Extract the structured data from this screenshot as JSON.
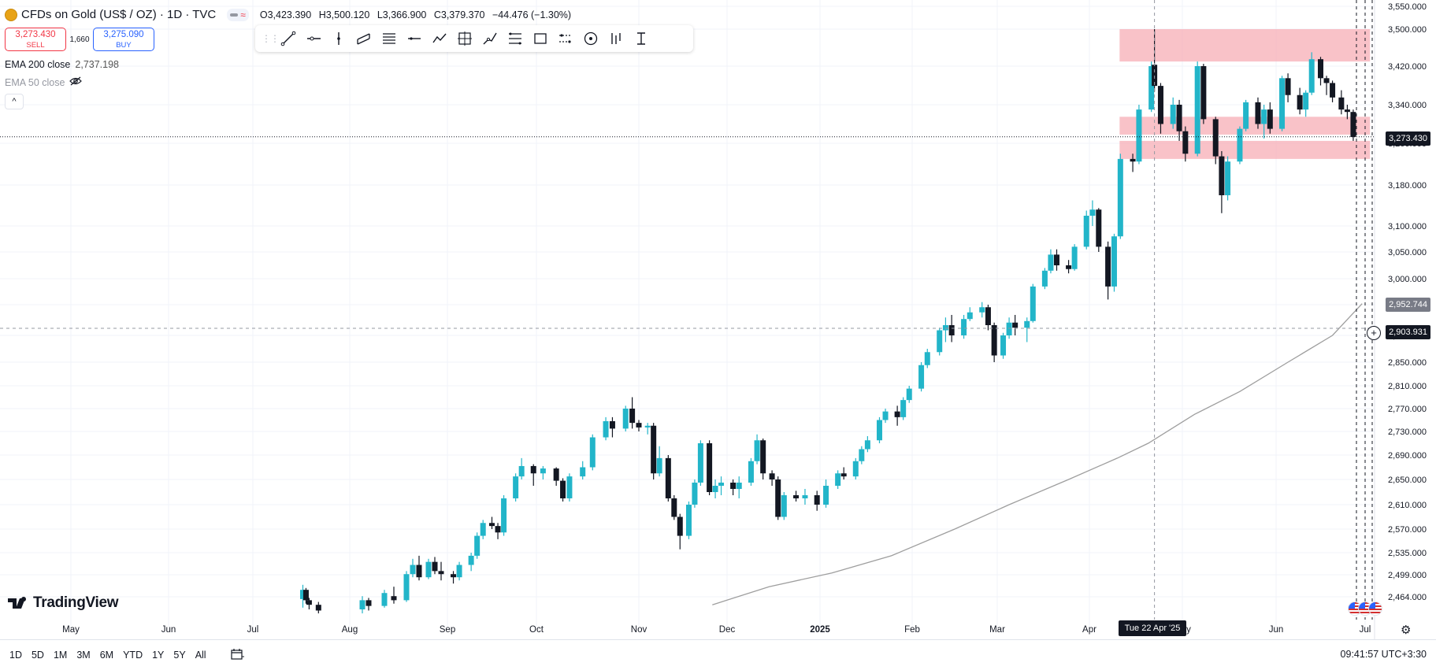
{
  "header": {
    "symbol": "CFDs on Gold (US$ / OZ) · 1D · TVC",
    "open": "O3,423.390",
    "high": "H3,500.120",
    "low": "L3,366.900",
    "close": "C3,379.370",
    "change": "−44.476 (−1.30%)"
  },
  "trade": {
    "sell_price": "3,273.430",
    "sell_label": "SELL",
    "spread": "1,660",
    "buy_price": "3,275.090",
    "buy_label": "BUY"
  },
  "indicators": {
    "ema200_label": "EMA 200 close",
    "ema200_value": "2,737.198",
    "ema50_label": "EMA 50 close",
    "collapse_icon": "^"
  },
  "price_tags": {
    "current": "3,273.430",
    "ema": "2,952.744",
    "crosshair": "2,903.931"
  },
  "crosshair_date": "Tue 22 Apr '25",
  "bottom": {
    "ranges": [
      "1D",
      "5D",
      "1M",
      "3M",
      "6M",
      "YTD",
      "1Y",
      "5Y",
      "All"
    ],
    "clock": "09:41:57 UTC+3:30"
  },
  "logo_text": "TradingView",
  "colors": {
    "up": "#22b5c9",
    "down": "#131722",
    "zone": "#f7a8b1",
    "ema": "#9e9e9e",
    "sell": "#f23645",
    "buy": "#2962ff"
  },
  "toolbar_icons": [
    "trend-line-icon",
    "horizontal-ray-icon",
    "vertical-line-icon",
    "parallel-channel-icon",
    "pitchfork-icon",
    "horizontal-line-icon",
    "path-icon",
    "date-price-range-icon",
    "brush-icon",
    "fib-retracement-icon",
    "rectangle-icon",
    "long-position-icon",
    "circle-icon",
    "bar-pattern-icon",
    "measure-icon"
  ],
  "chart_data": {
    "type": "candlestick",
    "y_ticks": [
      3550,
      3500,
      3420,
      3340,
      3260,
      3180,
      3100,
      3050,
      3000,
      2950,
      2890,
      2850,
      2810,
      2770,
      2730,
      2690,
      2650,
      2610,
      2570,
      2535,
      2499,
      2464
    ],
    "y_tick_labels": [
      "3,550.000",
      "3,500.000",
      "3,420.000",
      "3,340.000",
      "3,260.000",
      "3,180.000",
      "3,100.000",
      "3,050.000",
      "3,000.000",
      "2,950.000",
      "2,890.000",
      "2,850.000",
      "2,810.000",
      "2,770.000",
      "2,730.000",
      "2,690.000",
      "2,650.000",
      "2,610.000",
      "2,570.000",
      "2,535.000",
      "2,499.000",
      "2,464.000"
    ],
    "x_labels": [
      "May",
      "Jun",
      "Jul",
      "Aug",
      "Sep",
      "Oct",
      "Nov",
      "Dec",
      "2025",
      "Feb",
      "Mar",
      "Apr",
      "May",
      "Jun",
      "Jul"
    ],
    "x_label_dates": [
      "2024-05-01",
      "2024-06-01",
      "2024-07-01",
      "2024-08-01",
      "2024-09-01",
      "2024-10-01",
      "2024-11-01",
      "2024-12-01",
      "2025-01-01",
      "2025-02-01",
      "2025-03-01",
      "2025-04-01",
      "2025-05-01",
      "2025-06-01",
      "2025-07-01"
    ],
    "x_range": [
      "2024-04-20",
      "2025-07-02"
    ],
    "zones": [
      {
        "y_from": 3430,
        "y_to": 3500
      },
      {
        "y_from": 3278,
        "y_to": 3315
      },
      {
        "y_from": 3230,
        "y_to": 3265
      }
    ],
    "ema200": [
      {
        "d": "2024-11-26",
        "v": 2450
      },
      {
        "d": "2024-12-15",
        "v": 2480
      },
      {
        "d": "2025-01-05",
        "v": 2502
      },
      {
        "d": "2025-01-25",
        "v": 2530
      },
      {
        "d": "2025-02-15",
        "v": 2570
      },
      {
        "d": "2025-03-05",
        "v": 2610
      },
      {
        "d": "2025-03-25",
        "v": 2650
      },
      {
        "d": "2025-04-10",
        "v": 2685
      },
      {
        "d": "2025-04-20",
        "v": 2710
      },
      {
        "d": "2025-05-05",
        "v": 2760
      },
      {
        "d": "2025-05-20",
        "v": 2800
      },
      {
        "d": "2025-06-05",
        "v": 2850
      },
      {
        "d": "2025-06-20",
        "v": 2890
      },
      {
        "d": "2025-06-30",
        "v": 2952
      }
    ],
    "candles": [
      {
        "d": "2024-07-17",
        "o": 2460,
        "h": 2483,
        "l": 2445,
        "c": 2475
      },
      {
        "d": "2024-07-18",
        "o": 2475,
        "h": 2478,
        "l": 2452,
        "c": 2458
      },
      {
        "d": "2024-07-19",
        "o": 2458,
        "h": 2462,
        "l": 2442,
        "c": 2450
      },
      {
        "d": "2024-07-22",
        "o": 2450,
        "h": 2455,
        "l": 2435,
        "c": 2440
      },
      {
        "d": "2024-08-05",
        "o": 2442,
        "h": 2465,
        "l": 2435,
        "c": 2458
      },
      {
        "d": "2024-08-07",
        "o": 2458,
        "h": 2462,
        "l": 2440,
        "c": 2448
      },
      {
        "d": "2024-08-12",
        "o": 2448,
        "h": 2475,
        "l": 2445,
        "c": 2470
      },
      {
        "d": "2024-08-15",
        "o": 2465,
        "h": 2480,
        "l": 2452,
        "c": 2458
      },
      {
        "d": "2024-08-19",
        "o": 2458,
        "h": 2505,
        "l": 2455,
        "c": 2500
      },
      {
        "d": "2024-08-21",
        "o": 2500,
        "h": 2525,
        "l": 2495,
        "c": 2515
      },
      {
        "d": "2024-08-23",
        "o": 2515,
        "h": 2530,
        "l": 2490,
        "c": 2495
      },
      {
        "d": "2024-08-26",
        "o": 2495,
        "h": 2525,
        "l": 2492,
        "c": 2520
      },
      {
        "d": "2024-08-28",
        "o": 2520,
        "h": 2528,
        "l": 2500,
        "c": 2505
      },
      {
        "d": "2024-08-30",
        "o": 2505,
        "h": 2520,
        "l": 2490,
        "c": 2500
      },
      {
        "d": "2024-09-03",
        "o": 2500,
        "h": 2505,
        "l": 2485,
        "c": 2495
      },
      {
        "d": "2024-09-05",
        "o": 2495,
        "h": 2520,
        "l": 2490,
        "c": 2515
      },
      {
        "d": "2024-09-09",
        "o": 2515,
        "h": 2535,
        "l": 2505,
        "c": 2530
      },
      {
        "d": "2024-09-11",
        "o": 2530,
        "h": 2565,
        "l": 2525,
        "c": 2560
      },
      {
        "d": "2024-09-13",
        "o": 2560,
        "h": 2585,
        "l": 2555,
        "c": 2580
      },
      {
        "d": "2024-09-16",
        "o": 2580,
        "h": 2590,
        "l": 2570,
        "c": 2575
      },
      {
        "d": "2024-09-18",
        "o": 2575,
        "h": 2580,
        "l": 2555,
        "c": 2565
      },
      {
        "d": "2024-09-20",
        "o": 2565,
        "h": 2625,
        "l": 2560,
        "c": 2620
      },
      {
        "d": "2024-09-24",
        "o": 2620,
        "h": 2660,
        "l": 2615,
        "c": 2655
      },
      {
        "d": "2024-09-26",
        "o": 2655,
        "h": 2685,
        "l": 2650,
        "c": 2672
      },
      {
        "d": "2024-09-30",
        "o": 2672,
        "h": 2675,
        "l": 2640,
        "c": 2660
      },
      {
        "d": "2024-10-03",
        "o": 2660,
        "h": 2672,
        "l": 2650,
        "c": 2668
      },
      {
        "d": "2024-10-07",
        "o": 2668,
        "h": 2670,
        "l": 2640,
        "c": 2648
      },
      {
        "d": "2024-10-09",
        "o": 2648,
        "h": 2652,
        "l": 2615,
        "c": 2620
      },
      {
        "d": "2024-10-11",
        "o": 2620,
        "h": 2660,
        "l": 2615,
        "c": 2655
      },
      {
        "d": "2024-10-15",
        "o": 2655,
        "h": 2680,
        "l": 2650,
        "c": 2670
      },
      {
        "d": "2024-10-18",
        "o": 2670,
        "h": 2725,
        "l": 2665,
        "c": 2720
      },
      {
        "d": "2024-10-22",
        "o": 2720,
        "h": 2755,
        "l": 2715,
        "c": 2748
      },
      {
        "d": "2024-10-24",
        "o": 2748,
        "h": 2755,
        "l": 2720,
        "c": 2735
      },
      {
        "d": "2024-10-28",
        "o": 2735,
        "h": 2775,
        "l": 2730,
        "c": 2770
      },
      {
        "d": "2024-10-30",
        "o": 2770,
        "h": 2790,
        "l": 2735,
        "c": 2745
      },
      {
        "d": "2024-11-01",
        "o": 2745,
        "h": 2750,
        "l": 2730,
        "c": 2737
      },
      {
        "d": "2024-11-04",
        "o": 2737,
        "h": 2745,
        "l": 2725,
        "c": 2740
      },
      {
        "d": "2024-11-06",
        "o": 2740,
        "h": 2745,
        "l": 2650,
        "c": 2660
      },
      {
        "d": "2024-11-08",
        "o": 2660,
        "h": 2705,
        "l": 2655,
        "c": 2685
      },
      {
        "d": "2024-11-11",
        "o": 2685,
        "h": 2690,
        "l": 2615,
        "c": 2620
      },
      {
        "d": "2024-11-13",
        "o": 2620,
        "h": 2625,
        "l": 2585,
        "c": 2590
      },
      {
        "d": "2024-11-15",
        "o": 2590,
        "h": 2595,
        "l": 2540,
        "c": 2560
      },
      {
        "d": "2024-11-18",
        "o": 2560,
        "h": 2615,
        "l": 2555,
        "c": 2610
      },
      {
        "d": "2024-11-20",
        "o": 2610,
        "h": 2650,
        "l": 2605,
        "c": 2645
      },
      {
        "d": "2024-11-22",
        "o": 2645,
        "h": 2715,
        "l": 2640,
        "c": 2710
      },
      {
        "d": "2024-11-25",
        "o": 2710,
        "h": 2715,
        "l": 2625,
        "c": 2630
      },
      {
        "d": "2024-11-27",
        "o": 2630,
        "h": 2650,
        "l": 2620,
        "c": 2640
      },
      {
        "d": "2024-11-29",
        "o": 2640,
        "h": 2655,
        "l": 2625,
        "c": 2645
      },
      {
        "d": "2024-12-03",
        "o": 2645,
        "h": 2650,
        "l": 2625,
        "c": 2635
      },
      {
        "d": "2024-12-05",
        "o": 2635,
        "h": 2655,
        "l": 2620,
        "c": 2645
      },
      {
        "d": "2024-12-09",
        "o": 2645,
        "h": 2685,
        "l": 2640,
        "c": 2680
      },
      {
        "d": "2024-12-11",
        "o": 2680,
        "h": 2725,
        "l": 2675,
        "c": 2715
      },
      {
        "d": "2024-12-13",
        "o": 2715,
        "h": 2718,
        "l": 2650,
        "c": 2660
      },
      {
        "d": "2024-12-16",
        "o": 2660,
        "h": 2665,
        "l": 2640,
        "c": 2650
      },
      {
        "d": "2024-12-18",
        "o": 2650,
        "h": 2655,
        "l": 2585,
        "c": 2590
      },
      {
        "d": "2024-12-20",
        "o": 2590,
        "h": 2630,
        "l": 2585,
        "c": 2625
      },
      {
        "d": "2024-12-24",
        "o": 2625,
        "h": 2632,
        "l": 2615,
        "c": 2620
      },
      {
        "d": "2024-12-27",
        "o": 2620,
        "h": 2635,
        "l": 2610,
        "c": 2625
      },
      {
        "d": "2024-12-31",
        "o": 2625,
        "h": 2632,
        "l": 2600,
        "c": 2610
      },
      {
        "d": "2025-01-03",
        "o": 2610,
        "h": 2650,
        "l": 2605,
        "c": 2640
      },
      {
        "d": "2025-01-07",
        "o": 2640,
        "h": 2665,
        "l": 2635,
        "c": 2660
      },
      {
        "d": "2025-01-09",
        "o": 2660,
        "h": 2670,
        "l": 2650,
        "c": 2655
      },
      {
        "d": "2025-01-13",
        "o": 2655,
        "h": 2685,
        "l": 2650,
        "c": 2680
      },
      {
        "d": "2025-01-15",
        "o": 2680,
        "h": 2705,
        "l": 2675,
        "c": 2700
      },
      {
        "d": "2025-01-17",
        "o": 2700,
        "h": 2722,
        "l": 2695,
        "c": 2715
      },
      {
        "d": "2025-01-21",
        "o": 2715,
        "h": 2755,
        "l": 2710,
        "c": 2750
      },
      {
        "d": "2025-01-23",
        "o": 2750,
        "h": 2770,
        "l": 2745,
        "c": 2765
      },
      {
        "d": "2025-01-27",
        "o": 2765,
        "h": 2775,
        "l": 2740,
        "c": 2755
      },
      {
        "d": "2025-01-29",
        "o": 2755,
        "h": 2790,
        "l": 2750,
        "c": 2785
      },
      {
        "d": "2025-01-31",
        "o": 2785,
        "h": 2810,
        "l": 2780,
        "c": 2805
      },
      {
        "d": "2025-02-04",
        "o": 2805,
        "h": 2850,
        "l": 2800,
        "c": 2845
      },
      {
        "d": "2025-02-06",
        "o": 2845,
        "h": 2870,
        "l": 2840,
        "c": 2865
      },
      {
        "d": "2025-02-10",
        "o": 2865,
        "h": 2905,
        "l": 2860,
        "c": 2900
      },
      {
        "d": "2025-02-12",
        "o": 2900,
        "h": 2925,
        "l": 2880,
        "c": 2910
      },
      {
        "d": "2025-02-14",
        "o": 2910,
        "h": 2930,
        "l": 2880,
        "c": 2890
      },
      {
        "d": "2025-02-18",
        "o": 2890,
        "h": 2930,
        "l": 2885,
        "c": 2922
      },
      {
        "d": "2025-02-20",
        "o": 2922,
        "h": 2945,
        "l": 2918,
        "c": 2935
      },
      {
        "d": "2025-02-24",
        "o": 2935,
        "h": 2955,
        "l": 2925,
        "c": 2945
      },
      {
        "d": "2025-02-26",
        "o": 2945,
        "h": 2950,
        "l": 2900,
        "c": 2910
      },
      {
        "d": "2025-02-28",
        "o": 2910,
        "h": 2915,
        "l": 2850,
        "c": 2860
      },
      {
        "d": "2025-03-03",
        "o": 2860,
        "h": 2895,
        "l": 2855,
        "c": 2890
      },
      {
        "d": "2025-03-05",
        "o": 2890,
        "h": 2925,
        "l": 2885,
        "c": 2915
      },
      {
        "d": "2025-03-07",
        "o": 2915,
        "h": 2930,
        "l": 2890,
        "c": 2905
      },
      {
        "d": "2025-03-11",
        "o": 2905,
        "h": 2925,
        "l": 2880,
        "c": 2918
      },
      {
        "d": "2025-03-13",
        "o": 2918,
        "h": 2990,
        "l": 2915,
        "c": 2985
      },
      {
        "d": "2025-03-17",
        "o": 2985,
        "h": 3020,
        "l": 2980,
        "c": 3015
      },
      {
        "d": "2025-03-19",
        "o": 3015,
        "h": 3055,
        "l": 3010,
        "c": 3045
      },
      {
        "d": "2025-03-21",
        "o": 3045,
        "h": 3055,
        "l": 3015,
        "c": 3025
      },
      {
        "d": "2025-03-25",
        "o": 3025,
        "h": 3035,
        "l": 3010,
        "c": 3018
      },
      {
        "d": "2025-03-27",
        "o": 3018,
        "h": 3065,
        "l": 3015,
        "c": 3060
      },
      {
        "d": "2025-03-31",
        "o": 3060,
        "h": 3130,
        "l": 3055,
        "c": 3120
      },
      {
        "d": "2025-04-02",
        "o": 3120,
        "h": 3150,
        "l": 3100,
        "c": 3132
      },
      {
        "d": "2025-04-04",
        "o": 3132,
        "h": 3135,
        "l": 3050,
        "c": 3060
      },
      {
        "d": "2025-04-07",
        "o": 3060,
        "h": 3070,
        "l": 2960,
        "c": 2985
      },
      {
        "d": "2025-04-09",
        "o": 2985,
        "h": 3085,
        "l": 2975,
        "c": 3080
      },
      {
        "d": "2025-04-11",
        "o": 3080,
        "h": 3240,
        "l": 3075,
        "c": 3230
      },
      {
        "d": "2025-04-15",
        "o": 3230,
        "h": 3240,
        "l": 3205,
        "c": 3225
      },
      {
        "d": "2025-04-17",
        "o": 3225,
        "h": 3340,
        "l": 3220,
        "c": 3330
      },
      {
        "d": "2025-04-21",
        "o": 3330,
        "h": 3430,
        "l": 3325,
        "c": 3420
      },
      {
        "d": "2025-04-22",
        "o": 3423,
        "h": 3500,
        "l": 3367,
        "c": 3379
      },
      {
        "d": "2025-04-24",
        "o": 3379,
        "h": 3385,
        "l": 3280,
        "c": 3300
      },
      {
        "d": "2025-04-28",
        "o": 3300,
        "h": 3355,
        "l": 3290,
        "c": 3340
      },
      {
        "d": "2025-04-30",
        "o": 3340,
        "h": 3350,
        "l": 3265,
        "c": 3285
      },
      {
        "d": "2025-05-02",
        "o": 3285,
        "h": 3295,
        "l": 3225,
        "c": 3240
      },
      {
        "d": "2025-05-06",
        "o": 3240,
        "h": 3430,
        "l": 3235,
        "c": 3420
      },
      {
        "d": "2025-05-08",
        "o": 3420,
        "h": 3425,
        "l": 3300,
        "c": 3310
      },
      {
        "d": "2025-05-12",
        "o": 3310,
        "h": 3315,
        "l": 3220,
        "c": 3235
      },
      {
        "d": "2025-05-14",
        "o": 3235,
        "h": 3245,
        "l": 3125,
        "c": 3160
      },
      {
        "d": "2025-05-16",
        "o": 3160,
        "h": 3235,
        "l": 3150,
        "c": 3225
      },
      {
        "d": "2025-05-20",
        "o": 3225,
        "h": 3295,
        "l": 3220,
        "c": 3290
      },
      {
        "d": "2025-05-22",
        "o": 3290,
        "h": 3350,
        "l": 3285,
        "c": 3345
      },
      {
        "d": "2025-05-26",
        "o": 3345,
        "h": 3355,
        "l": 3290,
        "c": 3300
      },
      {
        "d": "2025-05-28",
        "o": 3300,
        "h": 3340,
        "l": 3270,
        "c": 3330
      },
      {
        "d": "2025-05-30",
        "o": 3330,
        "h": 3345,
        "l": 3280,
        "c": 3290
      },
      {
        "d": "2025-06-03",
        "o": 3290,
        "h": 3400,
        "l": 3285,
        "c": 3395
      },
      {
        "d": "2025-06-05",
        "o": 3395,
        "h": 3405,
        "l": 3345,
        "c": 3360
      },
      {
        "d": "2025-06-09",
        "o": 3360,
        "h": 3375,
        "l": 3320,
        "c": 3330
      },
      {
        "d": "2025-06-11",
        "o": 3330,
        "h": 3370,
        "l": 3315,
        "c": 3365
      },
      {
        "d": "2025-06-13",
        "o": 3365,
        "h": 3450,
        "l": 3360,
        "c": 3435
      },
      {
        "d": "2025-06-16",
        "o": 3435,
        "h": 3440,
        "l": 3380,
        "c": 3395
      },
      {
        "d": "2025-06-18",
        "o": 3395,
        "h": 3400,
        "l": 3360,
        "c": 3385
      },
      {
        "d": "2025-06-20",
        "o": 3385,
        "h": 3390,
        "l": 3345,
        "c": 3355
      },
      {
        "d": "2025-06-23",
        "o": 3355,
        "h": 3370,
        "l": 3320,
        "c": 3330
      },
      {
        "d": "2025-06-25",
        "o": 3330,
        "h": 3340,
        "l": 3310,
        "c": 3325
      },
      {
        "d": "2025-06-27",
        "o": 3325,
        "h": 3330,
        "l": 3265,
        "c": 3273
      }
    ]
  }
}
